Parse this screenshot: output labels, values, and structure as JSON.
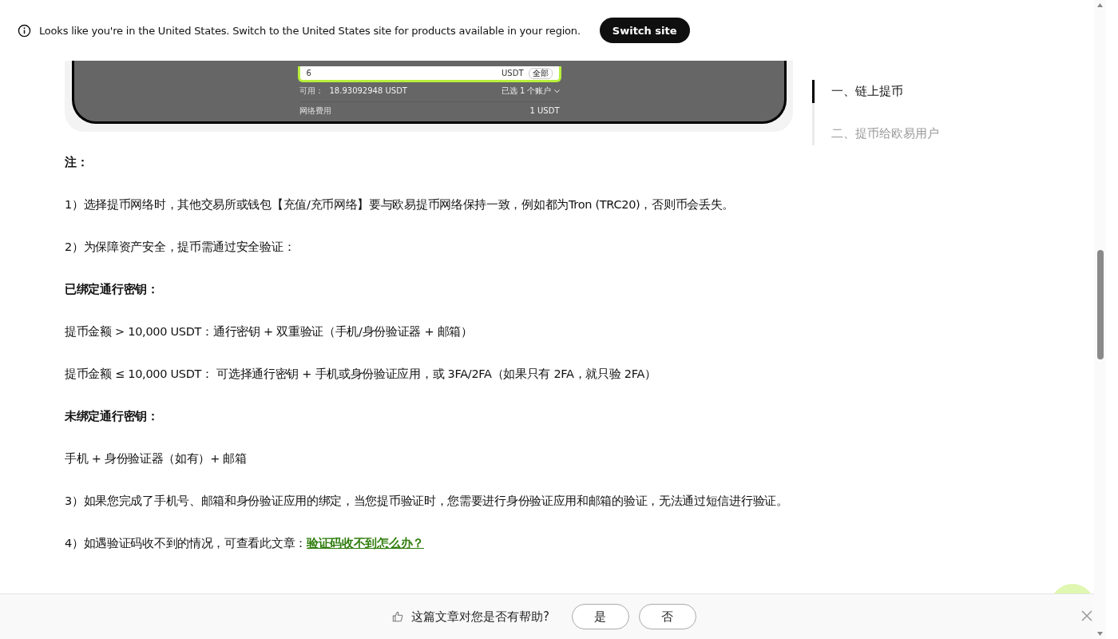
{
  "banner": {
    "message": "Looks like you're in the United States. Switch to the United States site for products available in your region.",
    "button": "Switch site"
  },
  "article_image": {
    "input_value": "6",
    "unit": "USDT",
    "all_button": "全部",
    "available_label": "可用：",
    "available_value": "18.93092948 USDT",
    "account_select": "已选 1 个账户",
    "fee_label": "网络费用",
    "fee_value": "1 USDT"
  },
  "paragraphs": [
    {
      "kind": "heading",
      "text": "注："
    },
    {
      "kind": "text",
      "text": "1）选择提币网络时，其他交易所或钱包【充值/充币网络】要与欧易提币网络保持一致，例如都为Tron (TRC20)，否则币会丢失。"
    },
    {
      "kind": "text",
      "text": "2）为保障资产安全，提币需通过安全验证："
    },
    {
      "kind": "heading",
      "text": "已绑定通行密钥："
    },
    {
      "kind": "text",
      "text": "提币金额 > 10,000 USDT：通行密钥 + 双重验证（手机/身份验证器 + 邮箱）"
    },
    {
      "kind": "text",
      "text": "提币金额 ≤ 10,000 USDT： 可选择通行密钥 + 手机或身份验证应用，或 3FA/2FA（如果只有 2FA，就只验 2FA）"
    },
    {
      "kind": "heading",
      "text": "未绑定通行密钥："
    },
    {
      "kind": "text",
      "text": "手机 + 身份验证器（如有）+ 邮箱"
    },
    {
      "kind": "text",
      "text": "3）如果您完成了手机号、邮箱和身份验证应用的绑定，当您提币验证时，您需要进行身份验证应用和邮箱的验证，无法通过短信进行验证。"
    },
    {
      "kind": "link",
      "text": "4）如遇验证码收不到的情况，可查看此文章：",
      "link": "验证码收不到怎么办？"
    }
  ],
  "toc": [
    {
      "label": "一、链上提币",
      "selected": true
    },
    {
      "label": "二、提币给欧易用户",
      "selected": false
    }
  ],
  "feedback": {
    "question": "这篇文章对您是否有帮助?",
    "buttons": [
      "是",
      "否"
    ]
  }
}
